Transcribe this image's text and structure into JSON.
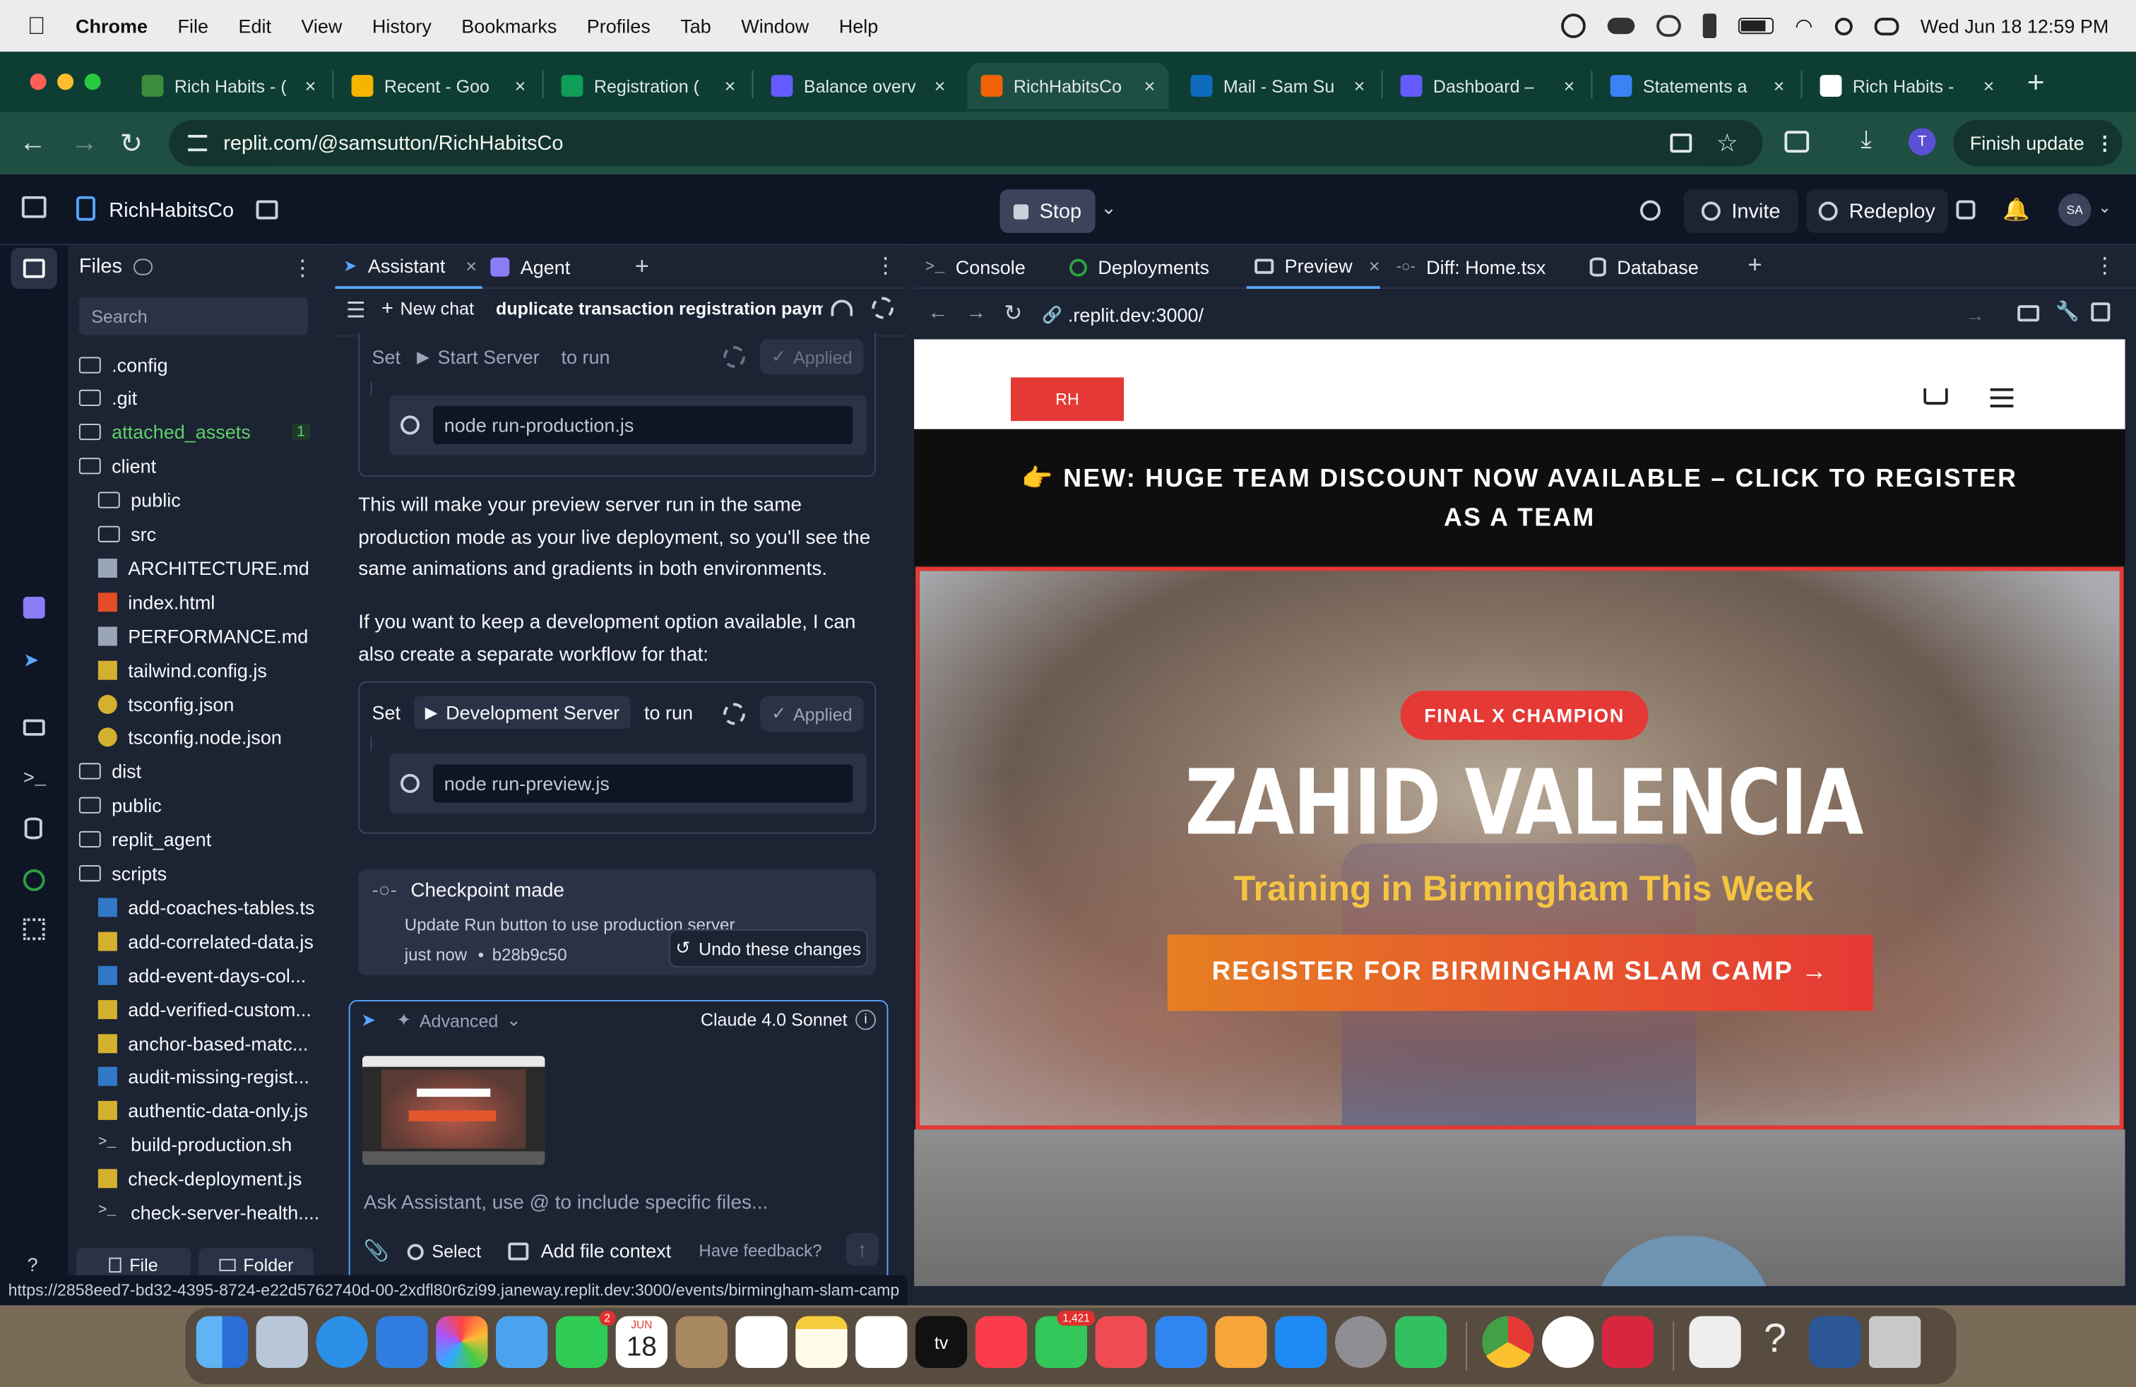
{
  "menubar": {
    "app": "Chrome",
    "items": [
      "File",
      "Edit",
      "View",
      "History",
      "Bookmarks",
      "Profiles",
      "Tab",
      "Window",
      "Help"
    ],
    "clock": "Wed Jun 18  12:59 PM"
  },
  "tabs": [
    {
      "label": "Rich Habits - (",
      "color": "#3c8c3c"
    },
    {
      "label": "Recent - Goo",
      "color": "#f4b400"
    },
    {
      "label": "Registration (",
      "color": "#0f9d58"
    },
    {
      "label": "Balance overv",
      "color": "#635bff"
    },
    {
      "label": "RichHabitsCo",
      "color": "#f26207"
    },
    {
      "label": "Mail - Sam Su",
      "color": "#0f6cbd"
    },
    {
      "label": "Dashboard – ",
      "color": "#635bff"
    },
    {
      "label": "Statements a",
      "color": "#3b82f6"
    },
    {
      "label": "Rich Habits - ",
      "color": "#ffffff"
    }
  ],
  "address": {
    "url": "replit.com/@samsutton/RichHabitsCo",
    "profile_initial": "T",
    "finish_update": "Finish update"
  },
  "replit": {
    "project": "RichHabitsCo",
    "stop": "Stop",
    "invite": "Invite",
    "redeploy": "Redeploy",
    "avatar": "SA"
  },
  "files": {
    "title": "Files",
    "search_placeholder": "Search",
    "items": [
      {
        "name": ".config",
        "type": "folder",
        "indent": 0
      },
      {
        "name": ".git",
        "type": "folder",
        "indent": 0
      },
      {
        "name": "attached_assets",
        "type": "folder",
        "indent": 0,
        "badge": "1"
      },
      {
        "name": "client",
        "type": "folder-open",
        "indent": 0
      },
      {
        "name": "public",
        "type": "folder",
        "indent": 1
      },
      {
        "name": "src",
        "type": "folder",
        "indent": 1
      },
      {
        "name": "ARCHITECTURE.md",
        "type": "md",
        "indent": 1
      },
      {
        "name": "index.html",
        "type": "html",
        "indent": 1
      },
      {
        "name": "PERFORMANCE.md",
        "type": "md",
        "indent": 1
      },
      {
        "name": "tailwind.config.js",
        "type": "js",
        "indent": 1
      },
      {
        "name": "tsconfig.json",
        "type": "json",
        "indent": 1
      },
      {
        "name": "tsconfig.node.json",
        "type": "json",
        "indent": 1
      },
      {
        "name": "dist",
        "type": "folder",
        "indent": 0
      },
      {
        "name": "public",
        "type": "folder",
        "indent": 0
      },
      {
        "name": "replit_agent",
        "type": "folder",
        "indent": 0
      },
      {
        "name": "scripts",
        "type": "folder-open",
        "indent": 0
      },
      {
        "name": "add-coaches-tables.ts",
        "type": "ts",
        "indent": 1
      },
      {
        "name": "add-correlated-data.js",
        "type": "js",
        "indent": 1
      },
      {
        "name": "add-event-days-col...",
        "type": "ts",
        "indent": 1
      },
      {
        "name": "add-verified-custom...",
        "type": "js",
        "indent": 1
      },
      {
        "name": "anchor-based-matc...",
        "type": "js",
        "indent": 1
      },
      {
        "name": "audit-missing-regist...",
        "type": "ts",
        "indent": 1
      },
      {
        "name": "authentic-data-only.js",
        "type": "js",
        "indent": 1
      },
      {
        "name": "build-production.sh",
        "type": "sh",
        "indent": 1
      },
      {
        "name": "check-deployment.js",
        "type": "js",
        "indent": 1
      },
      {
        "name": "check-server-health....",
        "type": "sh",
        "indent": 1
      }
    ],
    "new_file": "File",
    "new_folder": "Folder"
  },
  "assistant": {
    "tab_assistant": "Assistant",
    "tab_agent": "Agent",
    "new_chat": "New chat",
    "chat_title": "duplicate transaction registration paym...",
    "card1": {
      "set": "Set",
      "workflow": "Start Server",
      "to_run": "to run",
      "applied": "Applied",
      "command": "node run-production.js"
    },
    "para1": "This will make your preview server run in the same production mode as your live deployment, so you'll see the same animations and gradients in both environments.",
    "para2": "If you want to keep a development option available, I can also create a separate workflow for that:",
    "card2": {
      "set": "Set",
      "workflow": "Development Server",
      "to_run": "to run",
      "applied": "Applied",
      "command": "node run-preview.js"
    },
    "checkpoint": {
      "title": "Checkpoint made",
      "desc": "Update Run button to use production server",
      "time": "just now",
      "hash": "b28b9c50",
      "undo": "Undo these changes"
    },
    "input": {
      "mode": "Advanced",
      "model": "Claude 4.0 Sonnet",
      "placeholder": "Ask Assistant, use @ to include specific files...",
      "select": "Select",
      "add_context": "Add file context",
      "feedback": "Have feedback?"
    }
  },
  "right_tabs": [
    {
      "label": "Console"
    },
    {
      "label": "Deployments"
    },
    {
      "label": "Preview"
    },
    {
      "label": "Diff: Home.tsx"
    },
    {
      "label": "Database"
    }
  ],
  "preview": {
    "url": ".replit.dev:3000/",
    "site": {
      "logo": "RH",
      "banner": "👉 NEW: HUGE TEAM DISCOUNT NOW AVAILABLE – CLICK TO REGISTER AS A TEAM",
      "badge": "FINAL X CHAMPION",
      "headline": "ZAHID VALENCIA",
      "subheadline": "Training in Birmingham This Week",
      "cta": "REGISTER FOR BIRMINGHAM SLAM CAMP →"
    }
  },
  "status_url": "https://2858eed7-bd32-4395-8724-e22d5762740d-00-2xdfl80r6zi99.janeway.replit.dev:3000/events/birmingham-slam-camp",
  "dock": {
    "facetime_badge": "2",
    "calendar_month": "JUN",
    "calendar_day": "18",
    "messages_badge": "1,421"
  }
}
